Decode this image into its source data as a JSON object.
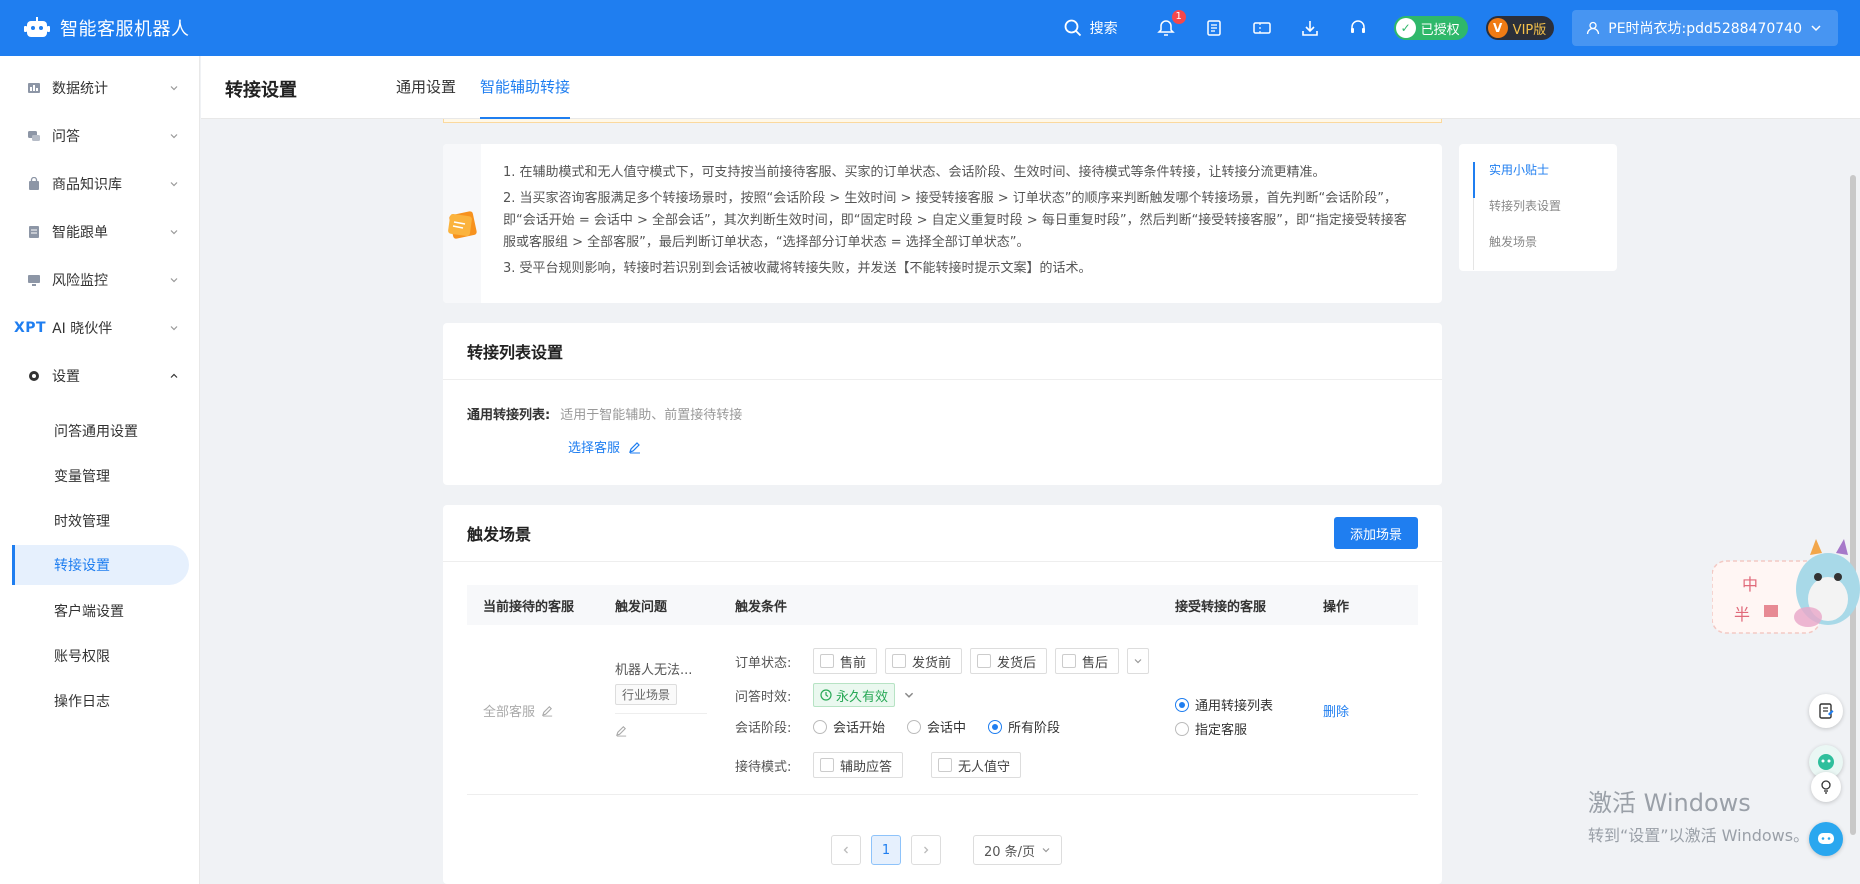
{
  "app": {
    "title": "智能客服机器人"
  },
  "topbar": {
    "search_label": "搜索",
    "notification_count": "1",
    "authorized_label": "已授权",
    "vip_label": "VIP版",
    "user_label": "PE时尚衣坊:pdd5288470740"
  },
  "sidebar": {
    "groups": [
      {
        "label": "数据统计"
      },
      {
        "label": "问答"
      },
      {
        "label": "商品知识库"
      },
      {
        "label": "智能跟单"
      },
      {
        "label": "风险监控"
      },
      {
        "label": "AI 晓伙伴",
        "logo": "XPT"
      },
      {
        "label": "设置"
      }
    ],
    "settings_items": [
      {
        "label": "问答通用设置"
      },
      {
        "label": "变量管理"
      },
      {
        "label": "时效管理"
      },
      {
        "label": "转接设置"
      },
      {
        "label": "客户端设置"
      },
      {
        "label": "账号权限"
      },
      {
        "label": "操作日志"
      }
    ]
  },
  "header": {
    "title": "转接设置",
    "tabs": [
      {
        "label": "通用设置"
      },
      {
        "label": "智能辅助转接"
      }
    ]
  },
  "tips": {
    "items": [
      "1. 在辅助模式和无人值守模式下，可支持按当前接待客服、买家的订单状态、会话阶段、生效时间、接待模式等条件转接，让转接分流更精准。",
      "2. 当买家咨询客服满足多个转接场景时，按照“会话阶段 > 生效时间 > 接受转接客服 > 订单状态”的顺序来判断触发哪个转接场景，首先判断“会话阶段”，即“会话开始 = 会话中 > 全部会话”，其次判断生效时间，即“固定时段 > 自定义重复时段 > 每日重复时段”，然后判断“接受转接客服”，即“指定接受转接客服或客服组 > 全部客服”，最后判断订单状态，“选择部分订单状态 = 选择全部订单状态”。",
      "3. 受平台规则影响，转接时若识别到会话被收藏将转接失败，并发送【不能转接时提示文案】的话术。"
    ]
  },
  "transfer_list": {
    "title": "转接列表设置",
    "field_label": "通用转接列表:",
    "field_hint": "适用于智能辅助、前置接待转接",
    "pick_label": "选择客服"
  },
  "trigger": {
    "title": "触发场景",
    "add_label": "添加场景",
    "columns": [
      "当前接待的客服",
      "触发问题",
      "触发条件",
      "接受转接的客服",
      "操作"
    ],
    "row": {
      "agent": "全部客服",
      "question": "机器人无法...",
      "question_tag": "行业场景",
      "order_status_label": "订单状态:",
      "order_status_options": [
        "售前",
        "发货前",
        "发货后",
        "售后"
      ],
      "validity_label": "问答时效:",
      "validity_value": "永久有效",
      "stage_label": "会话阶段:",
      "stage_options": [
        "会话开始",
        "会话中",
        "所有阶段"
      ],
      "stage_selected": "所有阶段",
      "mode_label": "接待模式:",
      "mode_options": [
        "辅助应答",
        "无人值守"
      ],
      "receiver_options": [
        "通用转接列表",
        "指定客服"
      ],
      "receiver_selected": "通用转接列表",
      "action_label": "删除"
    },
    "pagination": {
      "current_page": "1",
      "page_size": "20 条/页"
    }
  },
  "anchors": {
    "items": [
      "实用小贴士",
      "转接列表设置",
      "触发场景"
    ],
    "active": "实用小贴士"
  },
  "mascot": {
    "text1": "中",
    "text2": "半"
  },
  "watermark": {
    "line1": "激活 Windows",
    "line2": "转到“设置”以激活 Windows。"
  },
  "colors": {
    "primary": "#1f7ef0",
    "success": "#29a957",
    "badge": "#f5474b"
  }
}
